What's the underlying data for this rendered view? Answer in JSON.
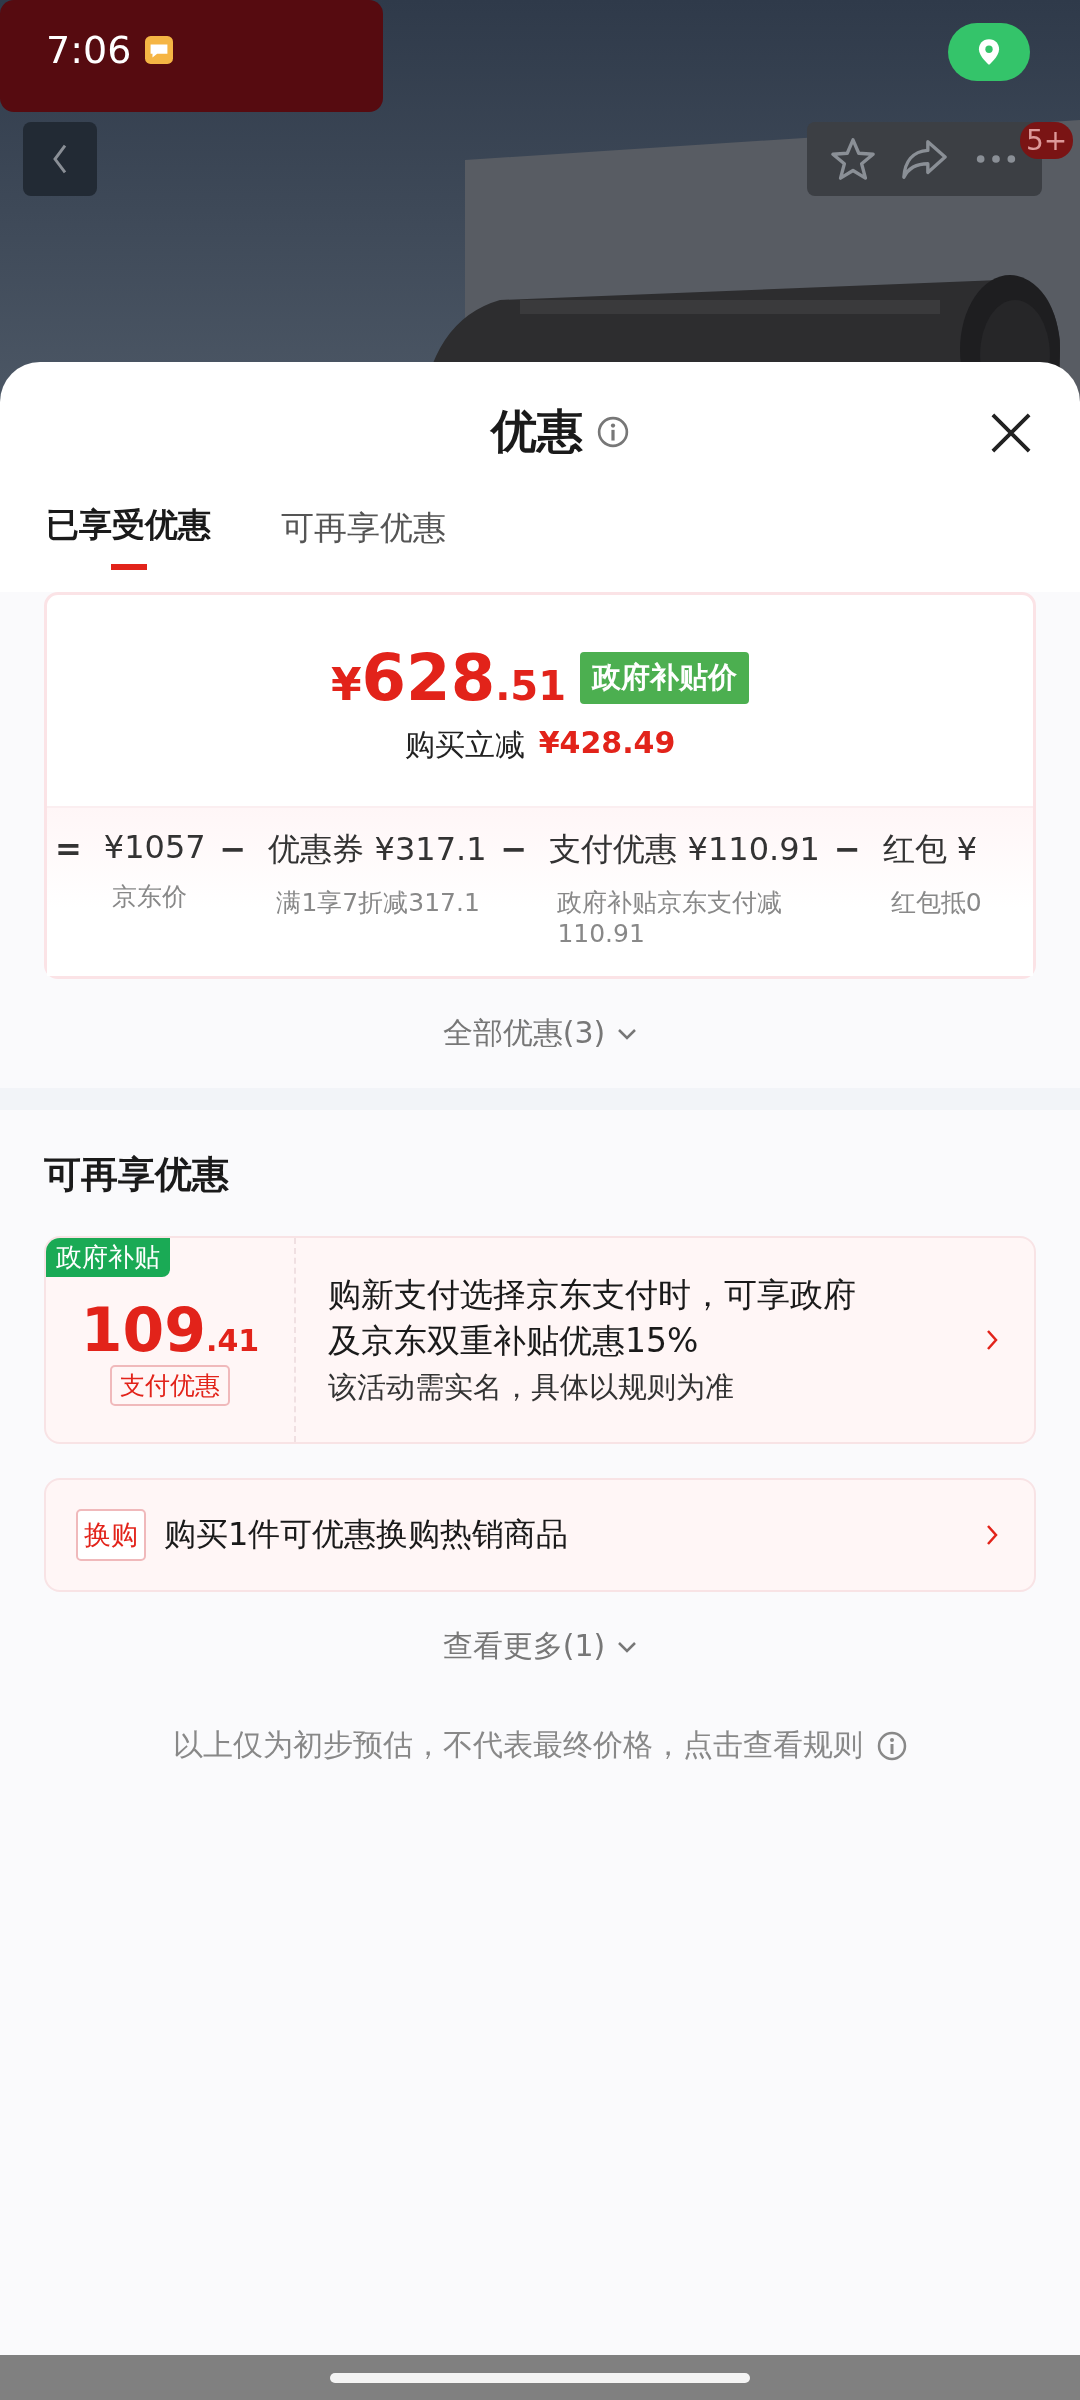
{
  "status_bar": {
    "time": "7:06"
  },
  "header": {
    "badge": "5+"
  },
  "sheet": {
    "title": "优惠"
  },
  "tabs": [
    {
      "label": "已享受优惠",
      "selected": true
    },
    {
      "label": "可再享优惠",
      "selected": false
    }
  ],
  "summary": {
    "currency": "¥",
    "price_int": "628",
    "price_dec": ".51",
    "price_tag": "政府补贴价",
    "reduction_label": "购买立减",
    "reduction_value": "¥428.49",
    "breakdown": [
      {
        "operator": "=",
        "amount": "¥1057",
        "note": "京东价"
      },
      {
        "operator": "−",
        "amount": "优惠券 ¥317.1",
        "note": "满1享7折减317.1"
      },
      {
        "operator": "−",
        "amount": "支付优惠 ¥110.91",
        "note": "政府补贴京东支付减110.91"
      },
      {
        "operator": "−",
        "amount": "红包 ¥",
        "note": "红包抵0"
      }
    ]
  },
  "all_offers": "全部优惠(3)",
  "more_section": {
    "heading": "可再享优惠",
    "offers": [
      {
        "kind": "coupon",
        "corner_tag": "政府补贴",
        "amount_int": "109",
        "amount_dec": ".41",
        "amount_label": "支付优惠",
        "title": "购新支付选择京东支付时，可享政府及京东双重补贴优惠15%",
        "subtitle": "该活动需实名，具体以规则为准"
      },
      {
        "kind": "exchange",
        "tag": "换购",
        "title": "购买1件可优惠换购热销商品"
      }
    ],
    "see_more": "查看更多(1)"
  },
  "footnote": "以上仅为初步预估，不代表最终价格，点击查看规则"
}
